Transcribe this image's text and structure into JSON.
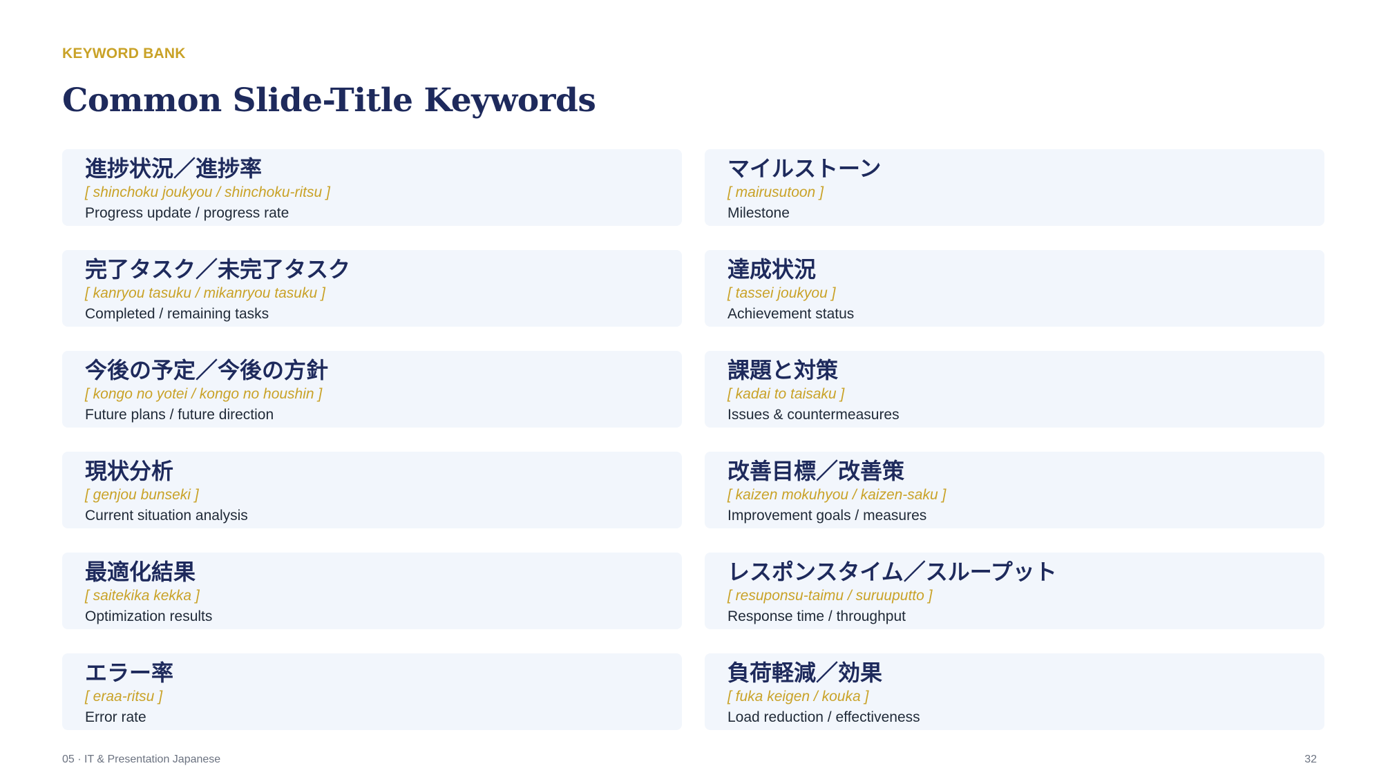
{
  "header": {
    "eyebrow": "KEYWORD BANK",
    "title": "Common Slide-Title Keywords"
  },
  "keywords": [
    {
      "jp": "進捗状況／進捗率",
      "romaji": "[ shinchoku joukyou / shinchoku-ritsu ]",
      "en": "Progress update / progress rate"
    },
    {
      "jp": "マイルストーン",
      "romaji": "[ mairusutoon ]",
      "en": "Milestone"
    },
    {
      "jp": "完了タスク／未完了タスク",
      "romaji": "[ kanryou tasuku / mikanryou tasuku ]",
      "en": "Completed / remaining tasks"
    },
    {
      "jp": "達成状況",
      "romaji": "[ tassei joukyou ]",
      "en": "Achievement status"
    },
    {
      "jp": "今後の予定／今後の方針",
      "romaji": "[ kongo no yotei / kongo no houshin ]",
      "en": "Future plans / future direction"
    },
    {
      "jp": "課題と対策",
      "romaji": "[ kadai to taisaku ]",
      "en": "Issues & countermeasures"
    },
    {
      "jp": "現状分析",
      "romaji": "[ genjou bunseki ]",
      "en": "Current situation analysis"
    },
    {
      "jp": "改善目標／改善策",
      "romaji": "[ kaizen mokuhyou / kaizen-saku ]",
      "en": "Improvement goals / measures"
    },
    {
      "jp": "最適化結果",
      "romaji": "[ saitekika kekka ]",
      "en": "Optimization results"
    },
    {
      "jp": "レスポンスタイム／スループット",
      "romaji": "[ resuponsu-taimu / suruuputto ]",
      "en": "Response time / throughput"
    },
    {
      "jp": "エラー率",
      "romaji": "[ eraa-ritsu ]",
      "en": "Error rate"
    },
    {
      "jp": "負荷軽減／効果",
      "romaji": "[ fuka keigen / kouka ]",
      "en": "Load reduction / effectiveness"
    }
  ],
  "footer": {
    "section": "05 · IT & Presentation Japanese",
    "page_number": "32"
  },
  "colors": {
    "accent_gold": "#c9a227",
    "navy": "#1e2a5c",
    "card_bg": "#f2f6fc"
  }
}
